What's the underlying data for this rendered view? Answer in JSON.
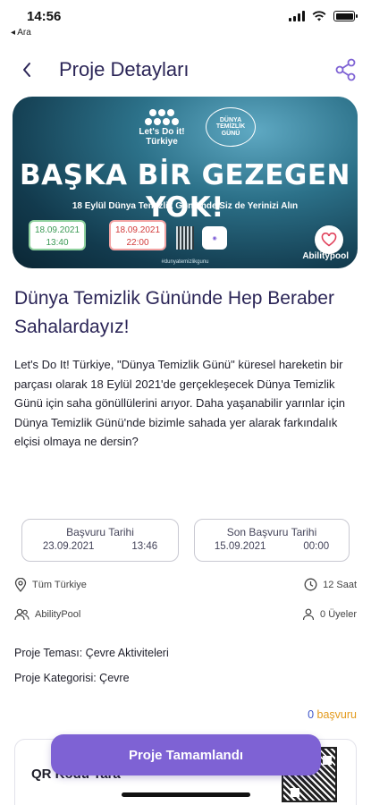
{
  "status": {
    "time": "14:56",
    "back_label": "◂ Ara"
  },
  "header": {
    "title": "Proje Detayları"
  },
  "banner": {
    "logo_text": "Let's Do it! Türkiye",
    "logo2_line1": "DÜNYA",
    "logo2_line2": "TEMİZLİK",
    "logo2_line3": "GÜNÜ",
    "headline": "BAŞKA BİR GEZEGEN YOK!",
    "subline": "18 Eylül Dünya Temizlik Günü'nde Siz de Yerinizi Alın",
    "start_date": "18.09.2021",
    "start_time": "13:40",
    "end_date": "18.09.2021",
    "end_time": "22:00",
    "footnote": "#dunyatemizlikgunu",
    "brand": "Abilitypool"
  },
  "project": {
    "title": "Dünya Temizlik Gününde Hep Beraber Sahalardayız!",
    "description": "Let's Do It! Türkiye, \"Dünya Temizlik Günü\" küresel hareketin bir parçası olarak 18 Eylül 2021'de gerçekleşecek Dünya Temizlik Günü için saha gönüllülerini arıyor. Daha yaşanabilir yarınlar için Dünya Temizlik Günü'nde bizimle sahada yer alarak farkındalık elçisi olmaya ne dersin?"
  },
  "dates": {
    "application": {
      "label": "Başvuru Tarihi",
      "date": "23.09.2021",
      "time": "13:46"
    },
    "deadline": {
      "label": "Son Başvuru Tarihi",
      "date": "15.09.2021",
      "time": "00:00"
    }
  },
  "meta": {
    "location": "Tüm Türkiye",
    "duration": "12 Saat",
    "organizer": "AbilityPool",
    "members": "0 Üyeler"
  },
  "attributes": {
    "theme": "Proje Teması: Çevre Aktiviteleri",
    "category": "Proje Kategorisi: Çevre"
  },
  "applications": {
    "count": "0",
    "label": "başvuru"
  },
  "qr": {
    "label": "QR Kodu Tara"
  },
  "cta": {
    "label": "Proje Tamamlandı"
  },
  "colors": {
    "accent": "#7e62d4",
    "title": "#2b2557",
    "orange": "#e39a1c"
  }
}
